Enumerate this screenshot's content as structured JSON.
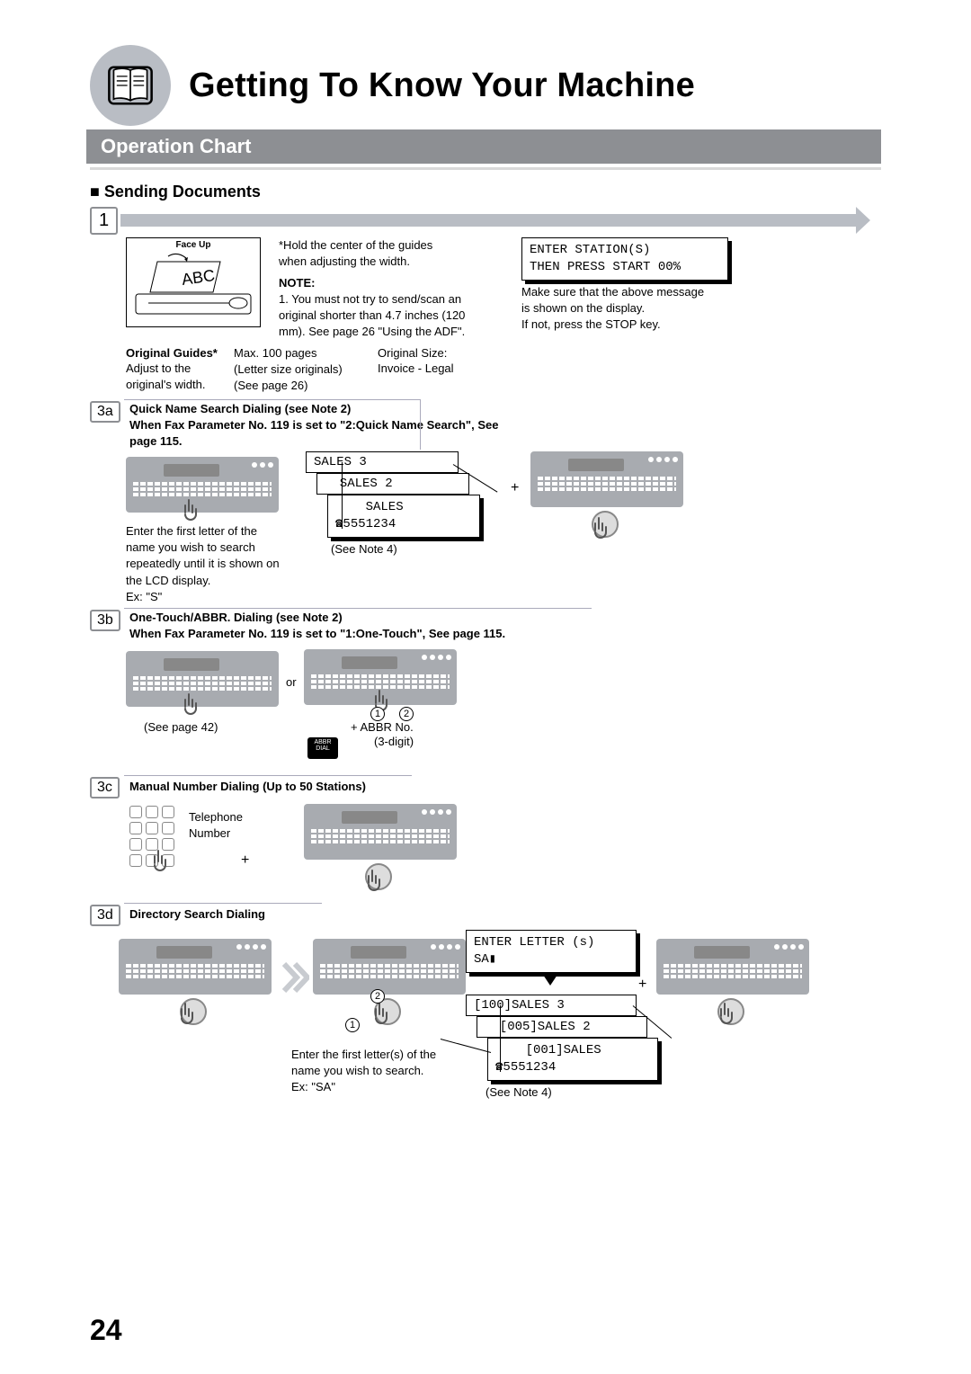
{
  "header": {
    "title": "Getting To Know Your Machine",
    "subtitle": "Operation Chart"
  },
  "section": {
    "title": "Sending Documents"
  },
  "steps": {
    "one": "1",
    "a": "3a",
    "b": "3b",
    "c": "3c",
    "d": "3d"
  },
  "top": {
    "hold_guides": "*Hold the center of the guides\n when adjusting the width.",
    "note_label": "NOTE:",
    "note1": "1. You must not try to send/scan an\n    original shorter than 4.7 inches (120\n    mm). See page 26 \"Using the ADF\".",
    "orig_guides_label": "Original Guides*",
    "orig_guides_text": "Adjust to the\noriginal's width.",
    "max_pages": "Max. 100 pages\n(Letter size originals)\n(See page 26)",
    "orig_size_label": "Original Size:",
    "orig_size_range": "Invoice - Legal",
    "lcd_enter_station": "ENTER STATION(S)\nTHEN PRESS START 00%",
    "confirm_msg": "Make sure that the above message\nis shown on the display.\nIf not, press the STOP key.",
    "face_up": "Face Up"
  },
  "s3a": {
    "heading": "Quick Name Search Dialing (see Note 2)\nWhen Fax Parameter No. 119 is set to \"2:Quick Name Search\", See\npage 115.",
    "instr": "Enter the first letter of the\nname you wish to search\nrepeatedly until it is shown on\nthe LCD display.\nEx: \"S\"",
    "lcd1": "SALES 3",
    "lcd2": "  SALES 2",
    "lcd3": "    SALES",
    "lcd4": "☎5551234",
    "see_note4": "(See Note 4)",
    "plus": "+"
  },
  "s3b": {
    "heading": "One-Touch/ABBR. Dialing (see Note 2)\nWhen Fax Parameter No. 119 is set to \"1:One-Touch\", See page 115.",
    "see_page42": "(See page 42)",
    "or": "or",
    "plus_abbr": "+   ABBR No.",
    "three_digit": "(3-digit)",
    "abbr_line1": "ABBR",
    "abbr_line2": "DIAL"
  },
  "s3c": {
    "heading": "Manual Number Dialing (Up to 50 Stations)",
    "tel": "Telephone\nNumber",
    "plus": "+"
  },
  "s3d": {
    "heading": "Directory Search Dialing",
    "lcd_enter": "ENTER LETTER (s)\nSA▮",
    "result1": "[100]SALES 3",
    "result2": "  [005]SALES 2",
    "result3": "    [001]SALES",
    "result4": "☎5551234",
    "instr": "Enter the first letter(s) of the\nname you wish to search.\nEx: \"SA\"",
    "see_note4": "(See Note 4)",
    "plus": "+"
  },
  "page_number": "24"
}
